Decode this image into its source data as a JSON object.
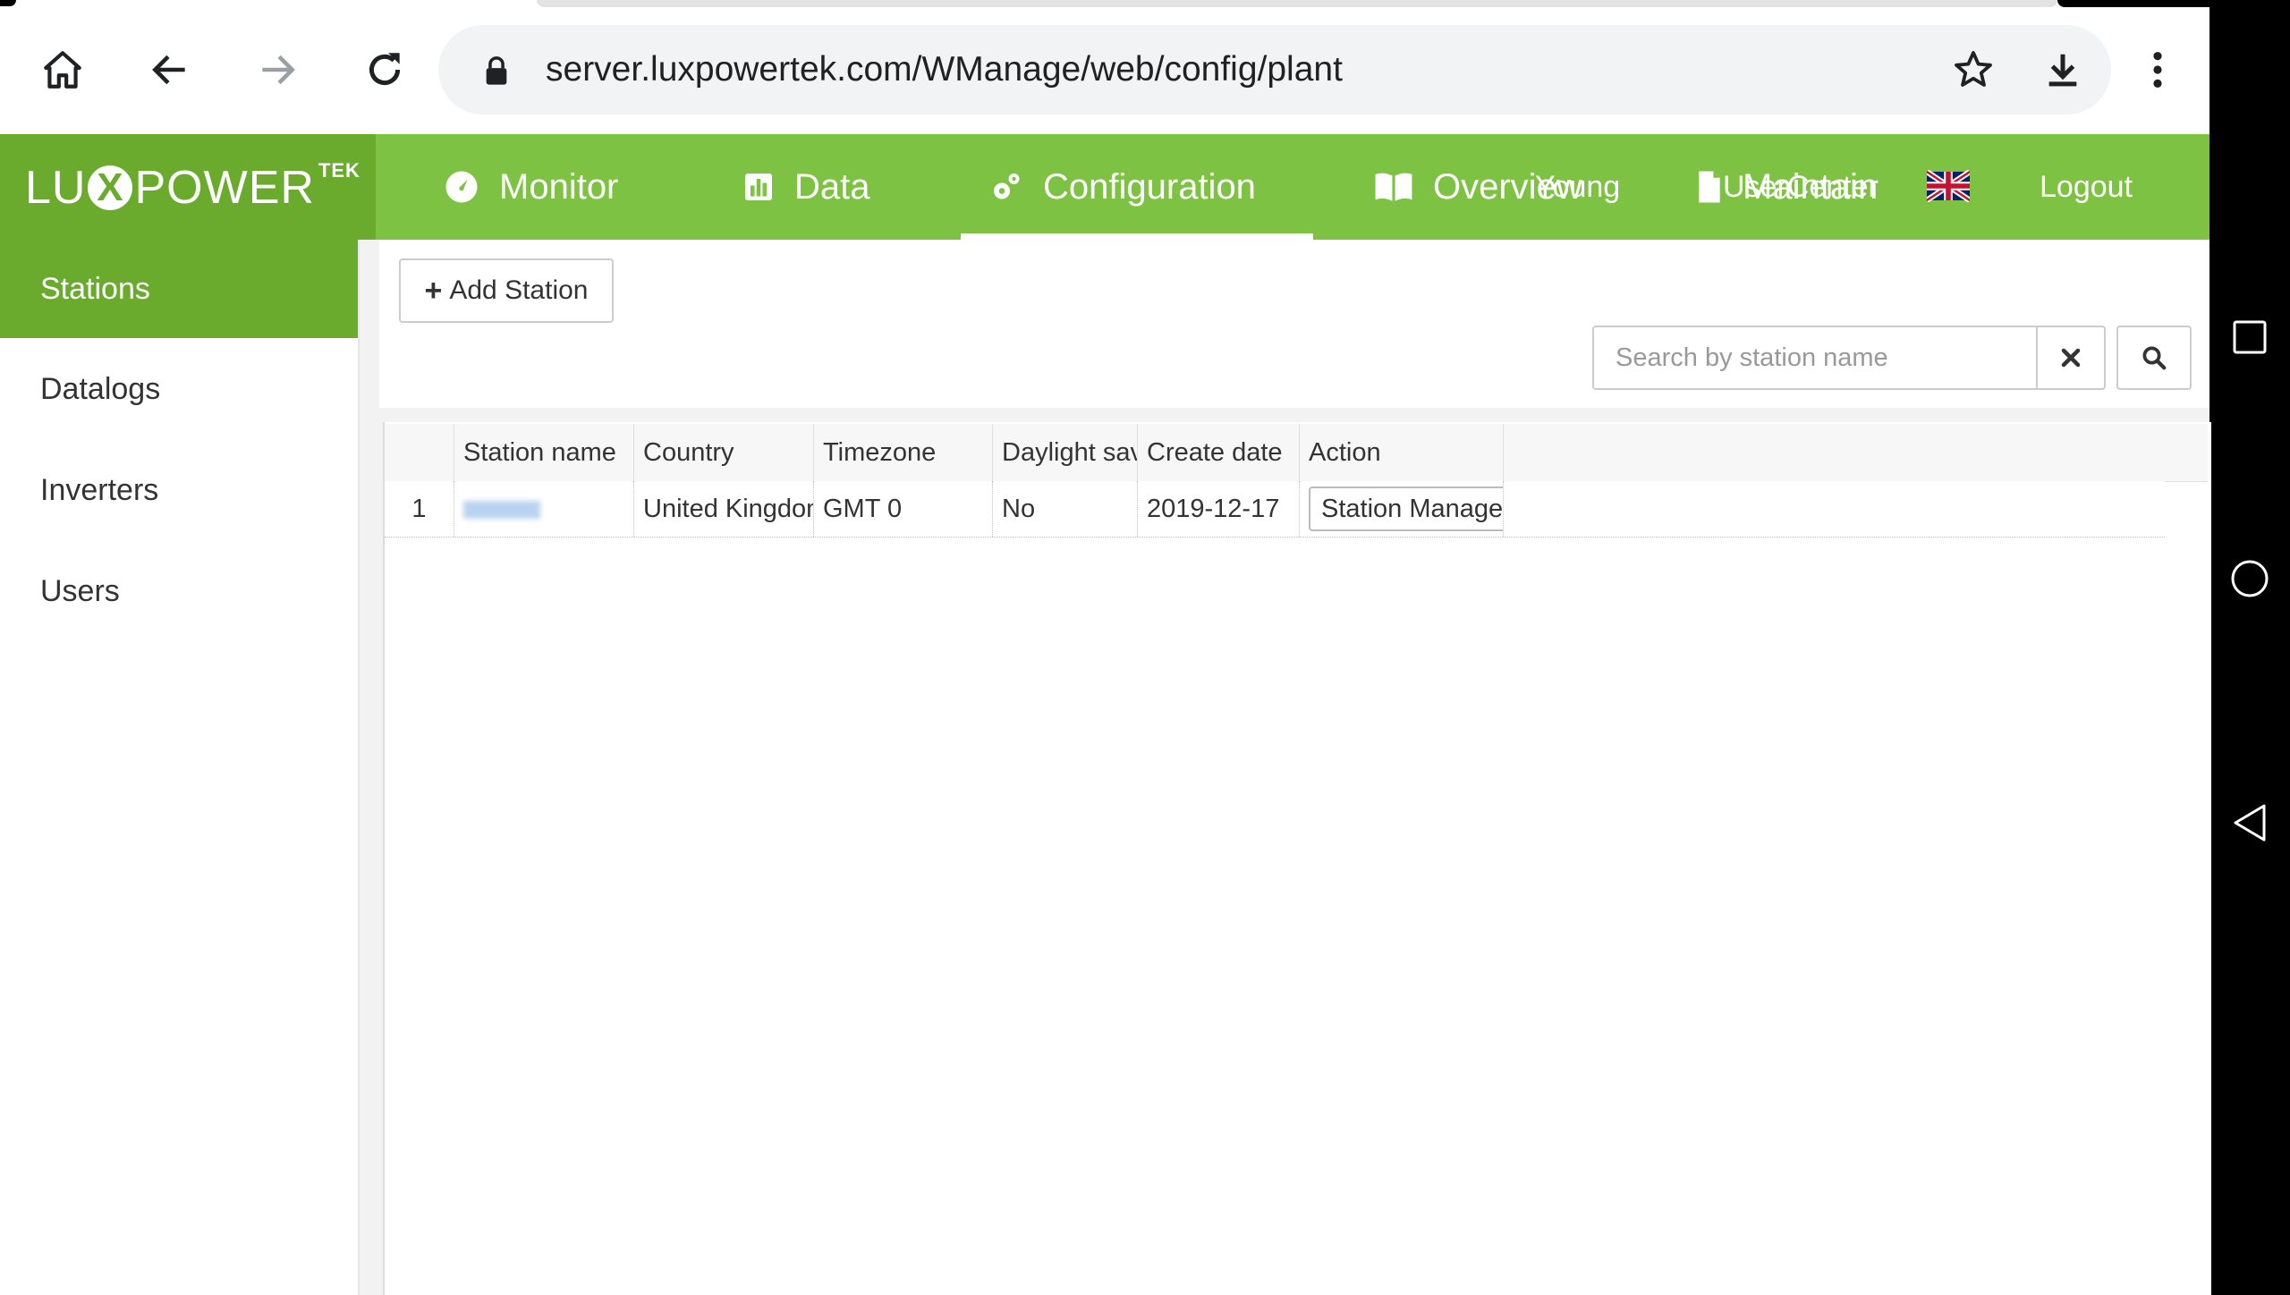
{
  "browser": {
    "url": "server.luxpowertek.com/WManage/web/config/plant",
    "icons": [
      "home-icon",
      "back-arrow-icon",
      "forward-arrow-icon",
      "reload-icon",
      "lock-icon",
      "star-icon",
      "download-icon",
      "more-vert-icon"
    ]
  },
  "brand": {
    "logo_left": "LU",
    "logo_x": "X",
    "logo_right": "POWER",
    "logo_sup": "TEK",
    "header_color": "#7dc242",
    "dark_green": "#6aab2e"
  },
  "nav": {
    "items": [
      {
        "label": "Monitor",
        "icon": "gauge-icon"
      },
      {
        "label": "Data",
        "icon": "bar-chart-icon"
      },
      {
        "label": "Configuration",
        "icon": "cogs-icon",
        "active": true
      },
      {
        "label": "Overview",
        "icon": "book-icon"
      },
      {
        "label": "Maintain",
        "icon": "document-icon"
      }
    ],
    "user": "Young",
    "user_center": "UserCenter",
    "language_icon": "uk-flag-icon",
    "logout": "Logout"
  },
  "sidebar": {
    "items": [
      {
        "label": "Stations",
        "active": true
      },
      {
        "label": "Datalogs"
      },
      {
        "label": "Inverters"
      },
      {
        "label": "Users"
      }
    ]
  },
  "toolbar": {
    "add_station": "Add Station",
    "search_placeholder": "Search by station name"
  },
  "table": {
    "columns": [
      "",
      "Station name",
      "Country",
      "Timezone",
      "Daylight saving tim",
      "Create date",
      "Action"
    ],
    "rows": [
      {
        "index": "1",
        "station_name": "",
        "country": "United Kingdom",
        "timezone": "GMT 0",
        "daylight_saving": "No",
        "create_date": "2019-12-17",
        "action": "Station Management"
      }
    ]
  },
  "android": {
    "buttons": [
      "recents-square-icon",
      "home-circle-icon",
      "back-triangle-icon"
    ]
  }
}
